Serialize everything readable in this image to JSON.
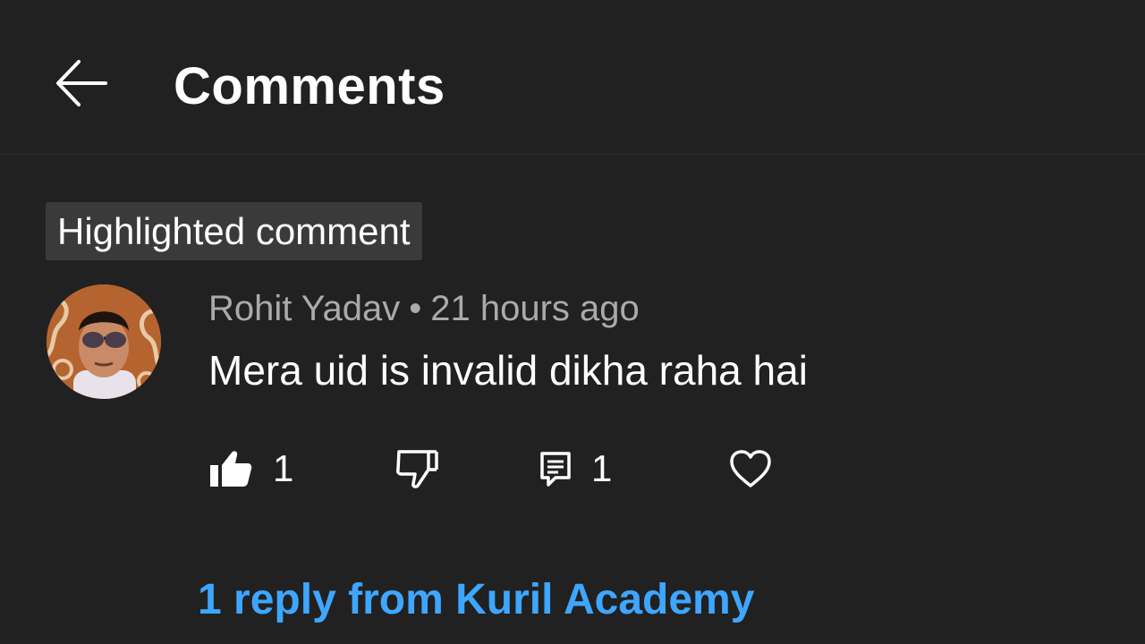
{
  "header": {
    "title": "Comments",
    "back_icon": "arrow-left-icon"
  },
  "highlighted_label": "Highlighted comment",
  "comment": {
    "author": "Rohit Yadav",
    "separator": "•",
    "time": "21 hours ago",
    "text": "Mera uid is invalid dikha raha hai",
    "likes": "1",
    "replies_count": "1",
    "like_state": "liked",
    "icons": {
      "like": "thumbs-up-filled-icon",
      "dislike": "thumbs-down-outline-icon",
      "reply": "comment-icon",
      "heart": "heart-outline-icon"
    }
  },
  "replies_link": "1 reply from Kuril Academy",
  "colors": {
    "background": "#212121",
    "link": "#3ea6ff",
    "meta": "#aaaaaa",
    "chip": "#3a3a3a"
  }
}
